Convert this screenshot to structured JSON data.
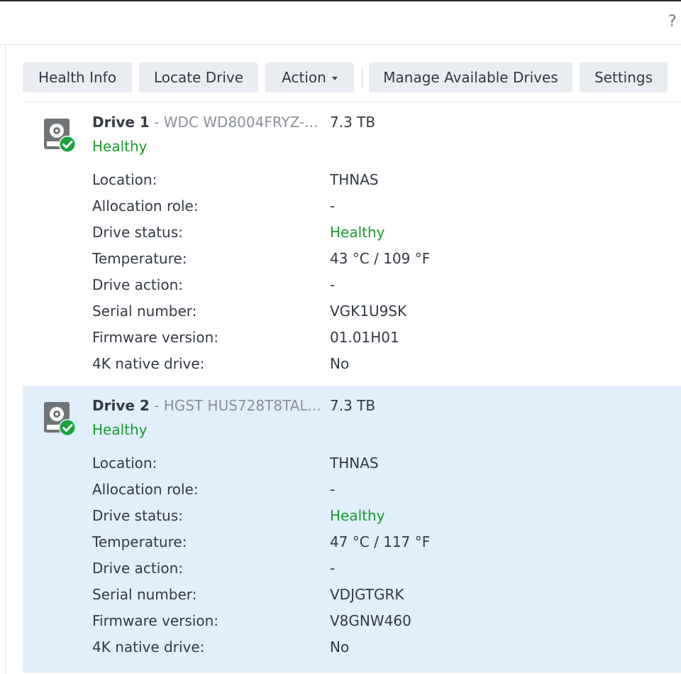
{
  "help_label": "?",
  "toolbar": {
    "health_info": "Health Info",
    "locate_drive": "Locate Drive",
    "action": "Action",
    "manage_available_drives": "Manage Available Drives",
    "settings": "Settings"
  },
  "colors": {
    "healthy": "#1a9b2e",
    "selected_bg": "#e1eefb",
    "button_bg": "#e9edf1"
  },
  "drives": [
    {
      "name": "Drive 1",
      "model_prefix": "- ",
      "model": "WDC WD8004FRYZ-...",
      "capacity": "7.3 TB",
      "health": "Healthy",
      "selected": false,
      "icon": "hard-drive-healthy-icon",
      "labels": {
        "location": "Location:",
        "allocation_role": "Allocation role:",
        "drive_status": "Drive status:",
        "temperature": "Temperature:",
        "drive_action": "Drive action:",
        "serial_number": "Serial number:",
        "firmware_version": "Firmware version:",
        "native_4k": "4K native drive:"
      },
      "values": {
        "location": "THNAS",
        "allocation_role": "-",
        "drive_status": "Healthy",
        "temperature": "43 °C / 109 °F",
        "drive_action": "-",
        "serial_number": "VGK1U9SK",
        "firmware_version": "01.01H01",
        "native_4k": "No"
      }
    },
    {
      "name": "Drive 2",
      "model_prefix": "- ",
      "model": "HGST HUS728T8TAL...",
      "capacity": "7.3 TB",
      "health": "Healthy",
      "selected": true,
      "icon": "hard-drive-healthy-icon",
      "labels": {
        "location": "Location:",
        "allocation_role": "Allocation role:",
        "drive_status": "Drive status:",
        "temperature": "Temperature:",
        "drive_action": "Drive action:",
        "serial_number": "Serial number:",
        "firmware_version": "Firmware version:",
        "native_4k": "4K native drive:"
      },
      "values": {
        "location": "THNAS",
        "allocation_role": "-",
        "drive_status": "Healthy",
        "temperature": "47 °C / 117 °F",
        "drive_action": "-",
        "serial_number": "VDJGTGRK",
        "firmware_version": "V8GNW460",
        "native_4k": "No"
      }
    }
  ]
}
